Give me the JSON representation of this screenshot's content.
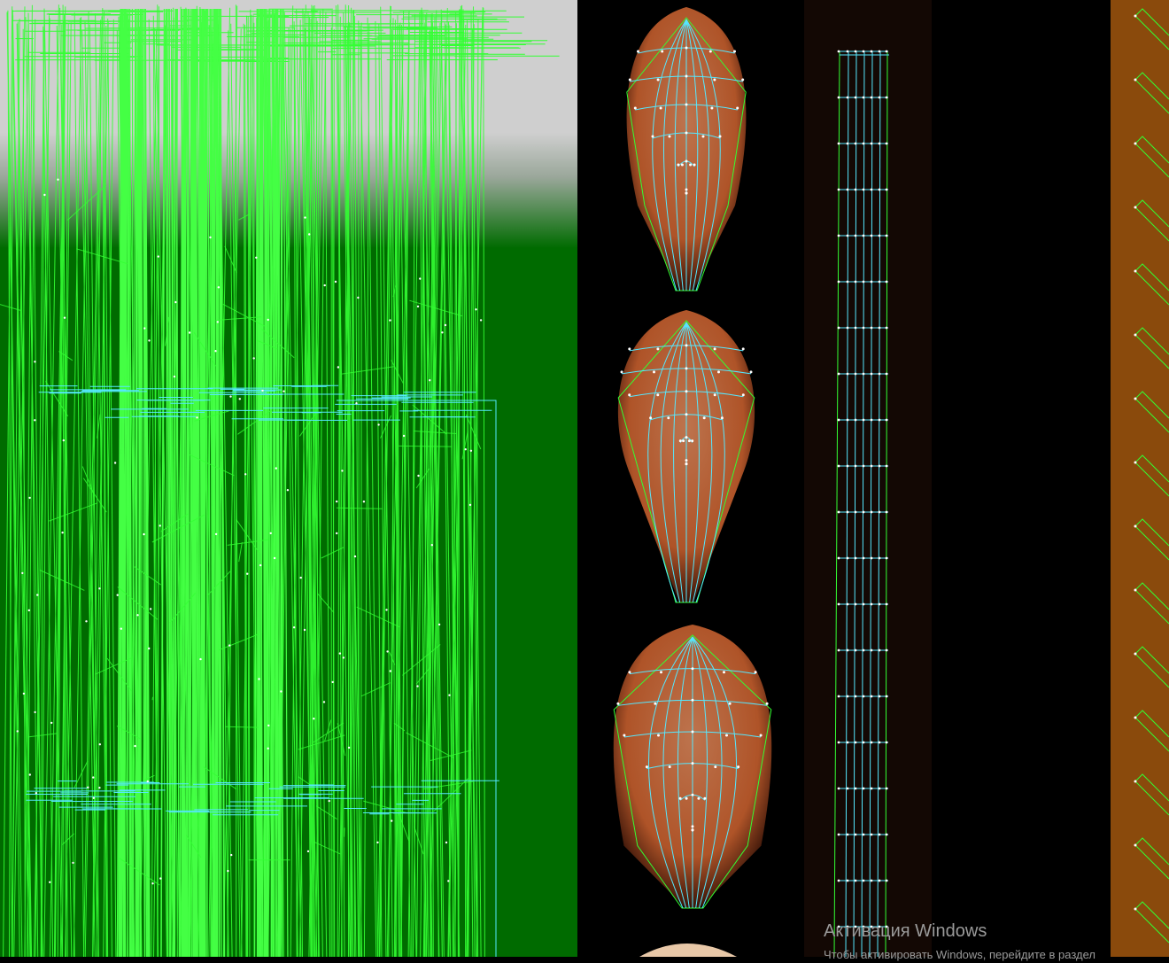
{
  "colors": {
    "wire_primary": "#33ff33",
    "wire_secondary": "#55e8ff",
    "vertex": "#ffffff",
    "skin": "#b8582a",
    "left_background": "#006b00",
    "brown_strip": "#8a4a0c"
  },
  "watermark": {
    "title": "Активация Windows",
    "subtitle": "Чтобы активировать Windows, перейдите в раздел"
  }
}
